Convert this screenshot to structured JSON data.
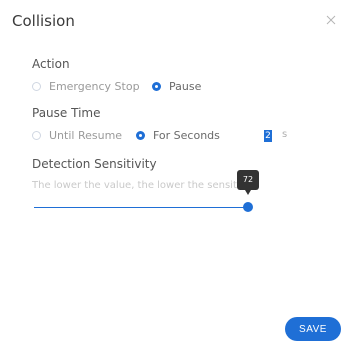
{
  "dialog": {
    "title": "Collision"
  },
  "action": {
    "label": "Action",
    "options": [
      {
        "label": "Emergency Stop",
        "selected": false
      },
      {
        "label": "Pause",
        "selected": true
      }
    ]
  },
  "pause_time": {
    "label": "Pause Time",
    "options": [
      {
        "label": "Until Resume",
        "selected": false
      },
      {
        "label": "For Seconds",
        "selected": true
      }
    ],
    "seconds_value": "2",
    "unit": "s"
  },
  "sensitivity": {
    "label": "Detection Sensitivity",
    "hint": "The lower the value, the lower the sensitivity",
    "value": 72
  },
  "footer": {
    "save_label": "SAVE"
  },
  "colors": {
    "accent": "#1f6fd6",
    "tooltip": "#333333"
  },
  "icons": {
    "close": "close-icon"
  }
}
